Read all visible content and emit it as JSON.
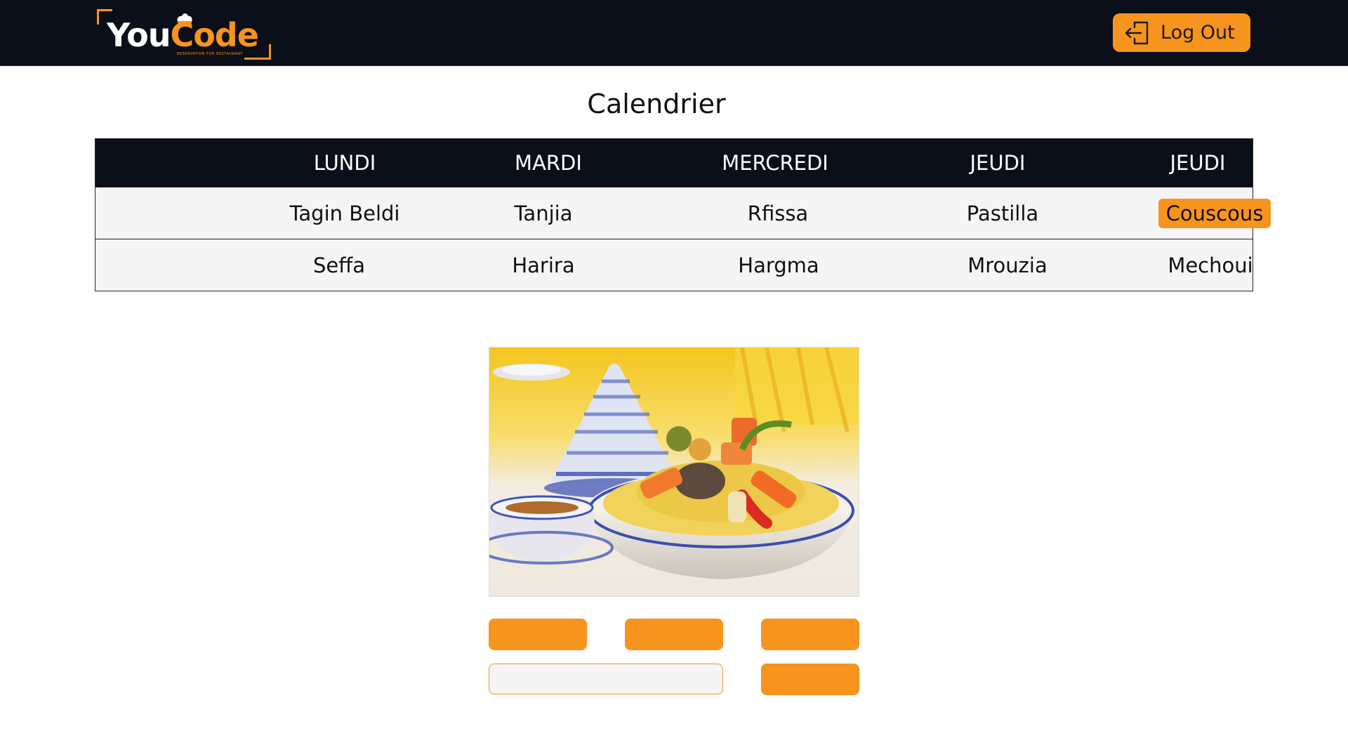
{
  "brand": {
    "name_part1": "You",
    "name_part2": "Code",
    "tagline": "RESERVATION FOR RESTAURANT"
  },
  "nav": {
    "logout_label": "Log Out"
  },
  "page": {
    "title": "Calendrier"
  },
  "calendar": {
    "days": [
      "LUNDI",
      "MARDI",
      "MERCREDI",
      "JEUDI",
      "JEUDI"
    ],
    "rows": [
      [
        "Tagin Beldi",
        "Tanjia",
        "Rfissa",
        "Pastilla",
        "Couscous"
      ],
      [
        "Seffa",
        "Harira",
        "Hargma",
        "Mrouzia",
        "Mechoui"
      ]
    ],
    "selected_dish": "Couscous"
  },
  "colors": {
    "accent": "#f7941d",
    "navbar": "#0b0f1a",
    "row_bg": "#f5f5f5"
  },
  "icons": {
    "logout": "logout-icon",
    "chef_hat": "chef-hat-icon"
  }
}
